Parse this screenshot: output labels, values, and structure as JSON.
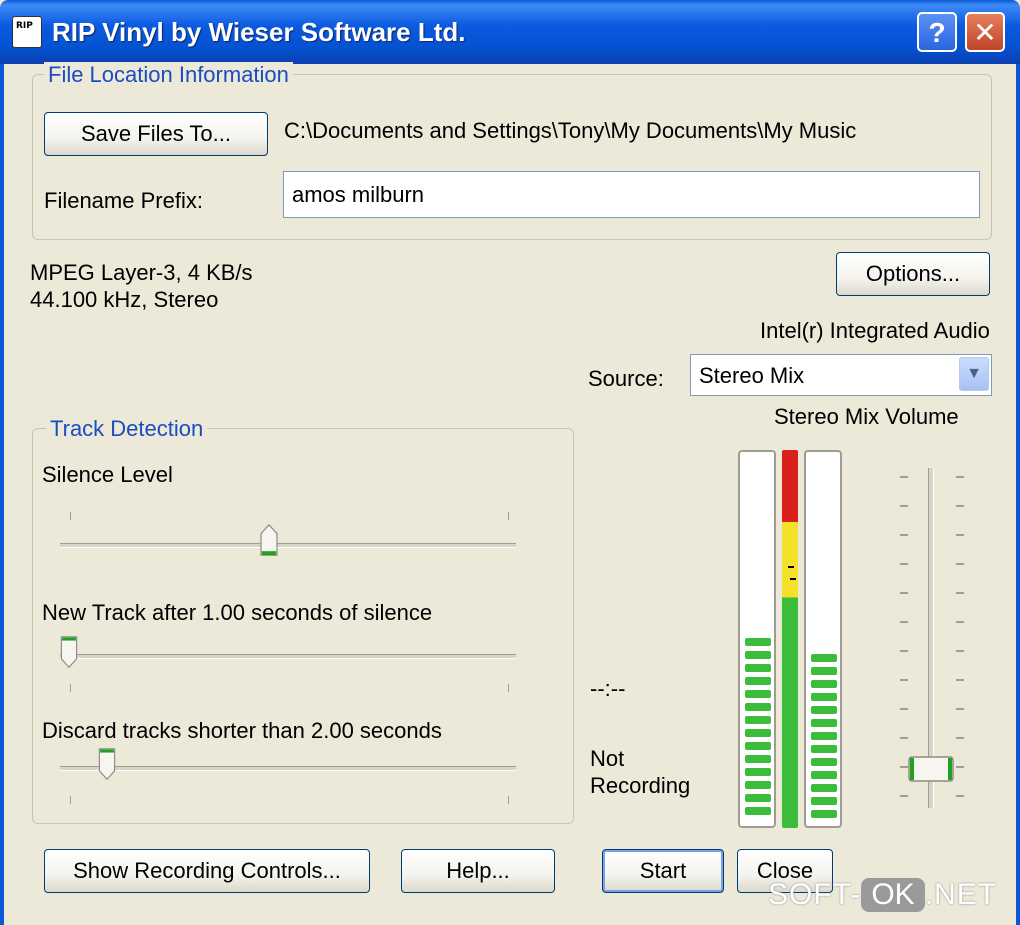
{
  "window": {
    "title": "RIP Vinyl by Wieser Software Ltd.",
    "icon_text": "RIP",
    "help_glyph": "?",
    "close_glyph": "✕"
  },
  "file_location": {
    "group_title": "File Location Information",
    "save_button_label": "Save Files To...",
    "save_path": "C:\\Documents and Settings\\Tony\\My Documents\\My Music",
    "prefix_label": "Filename Prefix:",
    "prefix_value": "amos milburn"
  },
  "format": {
    "line1": "MPEG Layer-3, 4 KB/s",
    "line2": "44.100 kHz, Stereo"
  },
  "options_button_label": "Options...",
  "device_name": "Intel(r) Integrated Audio",
  "source": {
    "label": "Source:",
    "value": "Stereo Mix"
  },
  "volume_label": "Stereo Mix Volume",
  "track_detection": {
    "group_title": "Track Detection",
    "silence_level_label": "Silence Level",
    "new_track_label": "New Track after 1.00 seconds of silence",
    "discard_label": "Discard tracks shorter than 2.00 seconds"
  },
  "status": {
    "time": "--:--",
    "state_line1": "Not",
    "state_line2": "Recording"
  },
  "buttons": {
    "show_controls": "Show Recording Controls...",
    "help": "Help...",
    "start": "Start",
    "close": "Close"
  },
  "watermark": {
    "part1": "SOFT-",
    "part2": "OK",
    "part3": ".NET"
  },
  "colors": {
    "title_blue": "#0452d1",
    "group_title_blue": "#1a4cc2",
    "meter_green": "#3bbd3b",
    "meter_yellow": "#f4e22a",
    "meter_red": "#d9201c"
  }
}
